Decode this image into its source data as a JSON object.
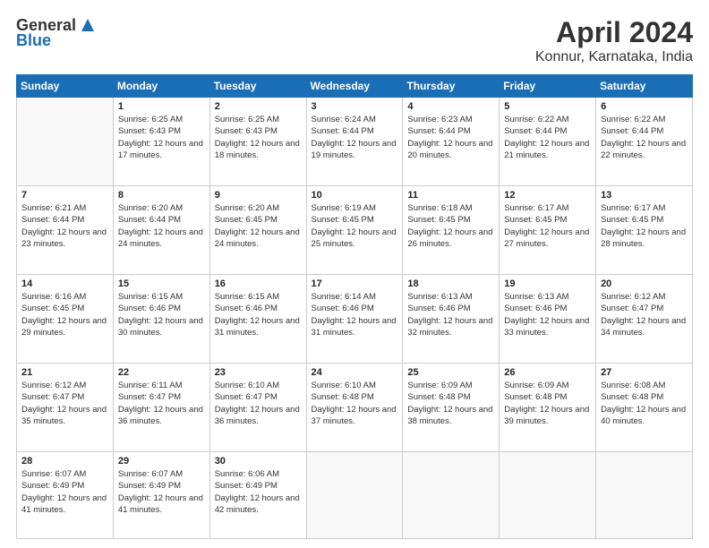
{
  "header": {
    "logo_general": "General",
    "logo_blue": "Blue",
    "title": "April 2024",
    "subtitle": "Konnur, Karnataka, India"
  },
  "calendar": {
    "days": [
      "Sunday",
      "Monday",
      "Tuesday",
      "Wednesday",
      "Thursday",
      "Friday",
      "Saturday"
    ],
    "rows": [
      [
        {
          "date": "",
          "sunrise": "",
          "sunset": "",
          "daylight": ""
        },
        {
          "date": "1",
          "sunrise": "Sunrise: 6:25 AM",
          "sunset": "Sunset: 6:43 PM",
          "daylight": "Daylight: 12 hours and 17 minutes."
        },
        {
          "date": "2",
          "sunrise": "Sunrise: 6:25 AM",
          "sunset": "Sunset: 6:43 PM",
          "daylight": "Daylight: 12 hours and 18 minutes."
        },
        {
          "date": "3",
          "sunrise": "Sunrise: 6:24 AM",
          "sunset": "Sunset: 6:44 PM",
          "daylight": "Daylight: 12 hours and 19 minutes."
        },
        {
          "date": "4",
          "sunrise": "Sunrise: 6:23 AM",
          "sunset": "Sunset: 6:44 PM",
          "daylight": "Daylight: 12 hours and 20 minutes."
        },
        {
          "date": "5",
          "sunrise": "Sunrise: 6:22 AM",
          "sunset": "Sunset: 6:44 PM",
          "daylight": "Daylight: 12 hours and 21 minutes."
        },
        {
          "date": "6",
          "sunrise": "Sunrise: 6:22 AM",
          "sunset": "Sunset: 6:44 PM",
          "daylight": "Daylight: 12 hours and 22 minutes."
        }
      ],
      [
        {
          "date": "7",
          "sunrise": "Sunrise: 6:21 AM",
          "sunset": "Sunset: 6:44 PM",
          "daylight": "Daylight: 12 hours and 23 minutes."
        },
        {
          "date": "8",
          "sunrise": "Sunrise: 6:20 AM",
          "sunset": "Sunset: 6:44 PM",
          "daylight": "Daylight: 12 hours and 24 minutes."
        },
        {
          "date": "9",
          "sunrise": "Sunrise: 6:20 AM",
          "sunset": "Sunset: 6:45 PM",
          "daylight": "Daylight: 12 hours and 24 minutes."
        },
        {
          "date": "10",
          "sunrise": "Sunrise: 6:19 AM",
          "sunset": "Sunset: 6:45 PM",
          "daylight": "Daylight: 12 hours and 25 minutes."
        },
        {
          "date": "11",
          "sunrise": "Sunrise: 6:18 AM",
          "sunset": "Sunset: 6:45 PM",
          "daylight": "Daylight: 12 hours and 26 minutes."
        },
        {
          "date": "12",
          "sunrise": "Sunrise: 6:17 AM",
          "sunset": "Sunset: 6:45 PM",
          "daylight": "Daylight: 12 hours and 27 minutes."
        },
        {
          "date": "13",
          "sunrise": "Sunrise: 6:17 AM",
          "sunset": "Sunset: 6:45 PM",
          "daylight": "Daylight: 12 hours and 28 minutes."
        }
      ],
      [
        {
          "date": "14",
          "sunrise": "Sunrise: 6:16 AM",
          "sunset": "Sunset: 6:45 PM",
          "daylight": "Daylight: 12 hours and 29 minutes."
        },
        {
          "date": "15",
          "sunrise": "Sunrise: 6:15 AM",
          "sunset": "Sunset: 6:46 PM",
          "daylight": "Daylight: 12 hours and 30 minutes."
        },
        {
          "date": "16",
          "sunrise": "Sunrise: 6:15 AM",
          "sunset": "Sunset: 6:46 PM",
          "daylight": "Daylight: 12 hours and 31 minutes."
        },
        {
          "date": "17",
          "sunrise": "Sunrise: 6:14 AM",
          "sunset": "Sunset: 6:46 PM",
          "daylight": "Daylight: 12 hours and 31 minutes."
        },
        {
          "date": "18",
          "sunrise": "Sunrise: 6:13 AM",
          "sunset": "Sunset: 6:46 PM",
          "daylight": "Daylight: 12 hours and 32 minutes."
        },
        {
          "date": "19",
          "sunrise": "Sunrise: 6:13 AM",
          "sunset": "Sunset: 6:46 PM",
          "daylight": "Daylight: 12 hours and 33 minutes."
        },
        {
          "date": "20",
          "sunrise": "Sunrise: 6:12 AM",
          "sunset": "Sunset: 6:47 PM",
          "daylight": "Daylight: 12 hours and 34 minutes."
        }
      ],
      [
        {
          "date": "21",
          "sunrise": "Sunrise: 6:12 AM",
          "sunset": "Sunset: 6:47 PM",
          "daylight": "Daylight: 12 hours and 35 minutes."
        },
        {
          "date": "22",
          "sunrise": "Sunrise: 6:11 AM",
          "sunset": "Sunset: 6:47 PM",
          "daylight": "Daylight: 12 hours and 36 minutes."
        },
        {
          "date": "23",
          "sunrise": "Sunrise: 6:10 AM",
          "sunset": "Sunset: 6:47 PM",
          "daylight": "Daylight: 12 hours and 36 minutes."
        },
        {
          "date": "24",
          "sunrise": "Sunrise: 6:10 AM",
          "sunset": "Sunset: 6:48 PM",
          "daylight": "Daylight: 12 hours and 37 minutes."
        },
        {
          "date": "25",
          "sunrise": "Sunrise: 6:09 AM",
          "sunset": "Sunset: 6:48 PM",
          "daylight": "Daylight: 12 hours and 38 minutes."
        },
        {
          "date": "26",
          "sunrise": "Sunrise: 6:09 AM",
          "sunset": "Sunset: 6:48 PM",
          "daylight": "Daylight: 12 hours and 39 minutes."
        },
        {
          "date": "27",
          "sunrise": "Sunrise: 6:08 AM",
          "sunset": "Sunset: 6:48 PM",
          "daylight": "Daylight: 12 hours and 40 minutes."
        }
      ],
      [
        {
          "date": "28",
          "sunrise": "Sunrise: 6:07 AM",
          "sunset": "Sunset: 6:49 PM",
          "daylight": "Daylight: 12 hours and 41 minutes."
        },
        {
          "date": "29",
          "sunrise": "Sunrise: 6:07 AM",
          "sunset": "Sunset: 6:49 PM",
          "daylight": "Daylight: 12 hours and 41 minutes."
        },
        {
          "date": "30",
          "sunrise": "Sunrise: 6:06 AM",
          "sunset": "Sunset: 6:49 PM",
          "daylight": "Daylight: 12 hours and 42 minutes."
        },
        {
          "date": "",
          "sunrise": "",
          "sunset": "",
          "daylight": ""
        },
        {
          "date": "",
          "sunrise": "",
          "sunset": "",
          "daylight": ""
        },
        {
          "date": "",
          "sunrise": "",
          "sunset": "",
          "daylight": ""
        },
        {
          "date": "",
          "sunrise": "",
          "sunset": "",
          "daylight": ""
        }
      ]
    ]
  }
}
